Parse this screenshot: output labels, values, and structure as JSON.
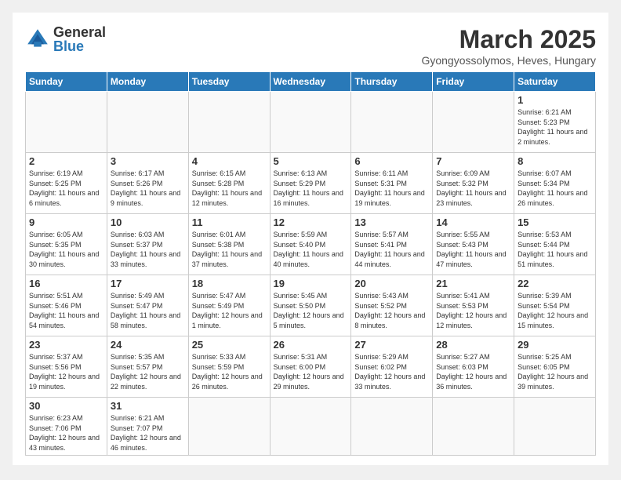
{
  "header": {
    "logo_general": "General",
    "logo_blue": "Blue",
    "month_title": "March 2025",
    "location": "Gyongyossolymos, Heves, Hungary"
  },
  "weekdays": [
    "Sunday",
    "Monday",
    "Tuesday",
    "Wednesday",
    "Thursday",
    "Friday",
    "Saturday"
  ],
  "weeks": [
    [
      {
        "day": "",
        "info": ""
      },
      {
        "day": "",
        "info": ""
      },
      {
        "day": "",
        "info": ""
      },
      {
        "day": "",
        "info": ""
      },
      {
        "day": "",
        "info": ""
      },
      {
        "day": "",
        "info": ""
      },
      {
        "day": "1",
        "info": "Sunrise: 6:21 AM\nSunset: 5:23 PM\nDaylight: 11 hours\nand 2 minutes."
      }
    ],
    [
      {
        "day": "2",
        "info": "Sunrise: 6:19 AM\nSunset: 5:25 PM\nDaylight: 11 hours\nand 6 minutes."
      },
      {
        "day": "3",
        "info": "Sunrise: 6:17 AM\nSunset: 5:26 PM\nDaylight: 11 hours\nand 9 minutes."
      },
      {
        "day": "4",
        "info": "Sunrise: 6:15 AM\nSunset: 5:28 PM\nDaylight: 11 hours\nand 12 minutes."
      },
      {
        "day": "5",
        "info": "Sunrise: 6:13 AM\nSunset: 5:29 PM\nDaylight: 11 hours\nand 16 minutes."
      },
      {
        "day": "6",
        "info": "Sunrise: 6:11 AM\nSunset: 5:31 PM\nDaylight: 11 hours\nand 19 minutes."
      },
      {
        "day": "7",
        "info": "Sunrise: 6:09 AM\nSunset: 5:32 PM\nDaylight: 11 hours\nand 23 minutes."
      },
      {
        "day": "8",
        "info": "Sunrise: 6:07 AM\nSunset: 5:34 PM\nDaylight: 11 hours\nand 26 minutes."
      }
    ],
    [
      {
        "day": "9",
        "info": "Sunrise: 6:05 AM\nSunset: 5:35 PM\nDaylight: 11 hours\nand 30 minutes."
      },
      {
        "day": "10",
        "info": "Sunrise: 6:03 AM\nSunset: 5:37 PM\nDaylight: 11 hours\nand 33 minutes."
      },
      {
        "day": "11",
        "info": "Sunrise: 6:01 AM\nSunset: 5:38 PM\nDaylight: 11 hours\nand 37 minutes."
      },
      {
        "day": "12",
        "info": "Sunrise: 5:59 AM\nSunset: 5:40 PM\nDaylight: 11 hours\nand 40 minutes."
      },
      {
        "day": "13",
        "info": "Sunrise: 5:57 AM\nSunset: 5:41 PM\nDaylight: 11 hours\nand 44 minutes."
      },
      {
        "day": "14",
        "info": "Sunrise: 5:55 AM\nSunset: 5:43 PM\nDaylight: 11 hours\nand 47 minutes."
      },
      {
        "day": "15",
        "info": "Sunrise: 5:53 AM\nSunset: 5:44 PM\nDaylight: 11 hours\nand 51 minutes."
      }
    ],
    [
      {
        "day": "16",
        "info": "Sunrise: 5:51 AM\nSunset: 5:46 PM\nDaylight: 11 hours\nand 54 minutes."
      },
      {
        "day": "17",
        "info": "Sunrise: 5:49 AM\nSunset: 5:47 PM\nDaylight: 11 hours\nand 58 minutes."
      },
      {
        "day": "18",
        "info": "Sunrise: 5:47 AM\nSunset: 5:49 PM\nDaylight: 12 hours\nand 1 minute."
      },
      {
        "day": "19",
        "info": "Sunrise: 5:45 AM\nSunset: 5:50 PM\nDaylight: 12 hours\nand 5 minutes."
      },
      {
        "day": "20",
        "info": "Sunrise: 5:43 AM\nSunset: 5:52 PM\nDaylight: 12 hours\nand 8 minutes."
      },
      {
        "day": "21",
        "info": "Sunrise: 5:41 AM\nSunset: 5:53 PM\nDaylight: 12 hours\nand 12 minutes."
      },
      {
        "day": "22",
        "info": "Sunrise: 5:39 AM\nSunset: 5:54 PM\nDaylight: 12 hours\nand 15 minutes."
      }
    ],
    [
      {
        "day": "23",
        "info": "Sunrise: 5:37 AM\nSunset: 5:56 PM\nDaylight: 12 hours\nand 19 minutes."
      },
      {
        "day": "24",
        "info": "Sunrise: 5:35 AM\nSunset: 5:57 PM\nDaylight: 12 hours\nand 22 minutes."
      },
      {
        "day": "25",
        "info": "Sunrise: 5:33 AM\nSunset: 5:59 PM\nDaylight: 12 hours\nand 26 minutes."
      },
      {
        "day": "26",
        "info": "Sunrise: 5:31 AM\nSunset: 6:00 PM\nDaylight: 12 hours\nand 29 minutes."
      },
      {
        "day": "27",
        "info": "Sunrise: 5:29 AM\nSunset: 6:02 PM\nDaylight: 12 hours\nand 33 minutes."
      },
      {
        "day": "28",
        "info": "Sunrise: 5:27 AM\nSunset: 6:03 PM\nDaylight: 12 hours\nand 36 minutes."
      },
      {
        "day": "29",
        "info": "Sunrise: 5:25 AM\nSunset: 6:05 PM\nDaylight: 12 hours\nand 39 minutes."
      }
    ],
    [
      {
        "day": "30",
        "info": "Sunrise: 6:23 AM\nSunset: 7:06 PM\nDaylight: 12 hours\nand 43 minutes."
      },
      {
        "day": "31",
        "info": "Sunrise: 6:21 AM\nSunset: 7:07 PM\nDaylight: 12 hours\nand 46 minutes."
      },
      {
        "day": "",
        "info": ""
      },
      {
        "day": "",
        "info": ""
      },
      {
        "day": "",
        "info": ""
      },
      {
        "day": "",
        "info": ""
      },
      {
        "day": "",
        "info": ""
      }
    ]
  ]
}
